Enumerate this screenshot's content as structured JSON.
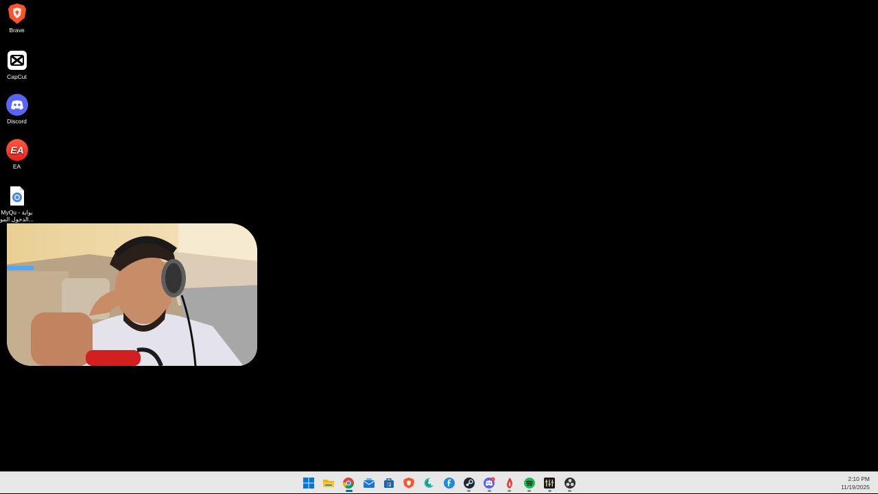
{
  "desktop": {
    "icons": [
      {
        "label": "Brave",
        "icon": "brave-icon"
      },
      {
        "label": "CapCut",
        "icon": "capcut-icon"
      },
      {
        "label": "Discord",
        "icon": "discord-icon"
      },
      {
        "label": "EA",
        "icon": "ea-icon"
      },
      {
        "label": "MyQu - بوابة الدخول المو...",
        "icon": "chrome-shortcut-icon"
      }
    ],
    "background_color": "#000000"
  },
  "webcam": {
    "name": "webcam-overlay"
  },
  "taskbar": {
    "apps": [
      {
        "name": "start-button",
        "icon": "windows-start-icon"
      },
      {
        "name": "file-explorer",
        "icon": "folder-icon"
      },
      {
        "name": "chrome",
        "icon": "chrome-icon",
        "state": "active"
      },
      {
        "name": "mail",
        "icon": "mail-icon"
      },
      {
        "name": "store",
        "icon": "store-icon"
      },
      {
        "name": "brave",
        "icon": "brave-icon"
      },
      {
        "name": "app-c",
        "icon": "crescent-icon"
      },
      {
        "name": "app-f",
        "icon": "f-icon"
      },
      {
        "name": "steam",
        "icon": "steam-icon",
        "state": "running"
      },
      {
        "name": "discord",
        "icon": "discord-icon",
        "state": "running",
        "badge": "1"
      },
      {
        "name": "app-flame",
        "icon": "flame-icon",
        "state": "running"
      },
      {
        "name": "spotify",
        "icon": "spotify-icon",
        "state": "running"
      },
      {
        "name": "app-mixer",
        "icon": "mixer-icon",
        "state": "running"
      },
      {
        "name": "obs",
        "icon": "obs-icon",
        "state": "running"
      }
    ],
    "clock": {
      "time": "2:10 PM",
      "date": "11/19/2025"
    }
  }
}
